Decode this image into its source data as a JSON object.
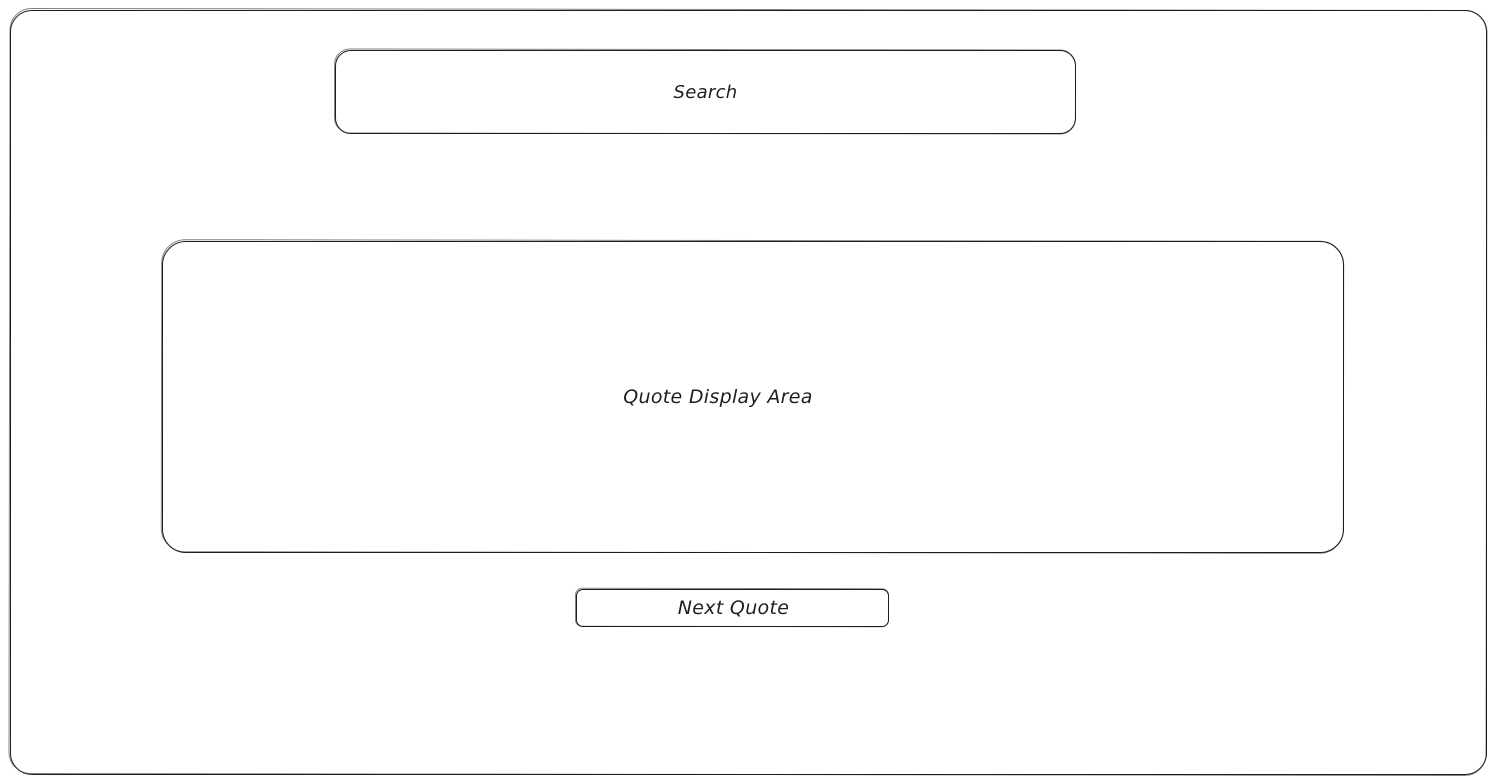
{
  "search": {
    "label": "Search"
  },
  "quote_area": {
    "label": "Quote Display Area"
  },
  "next_button": {
    "label": "Next Quote"
  }
}
